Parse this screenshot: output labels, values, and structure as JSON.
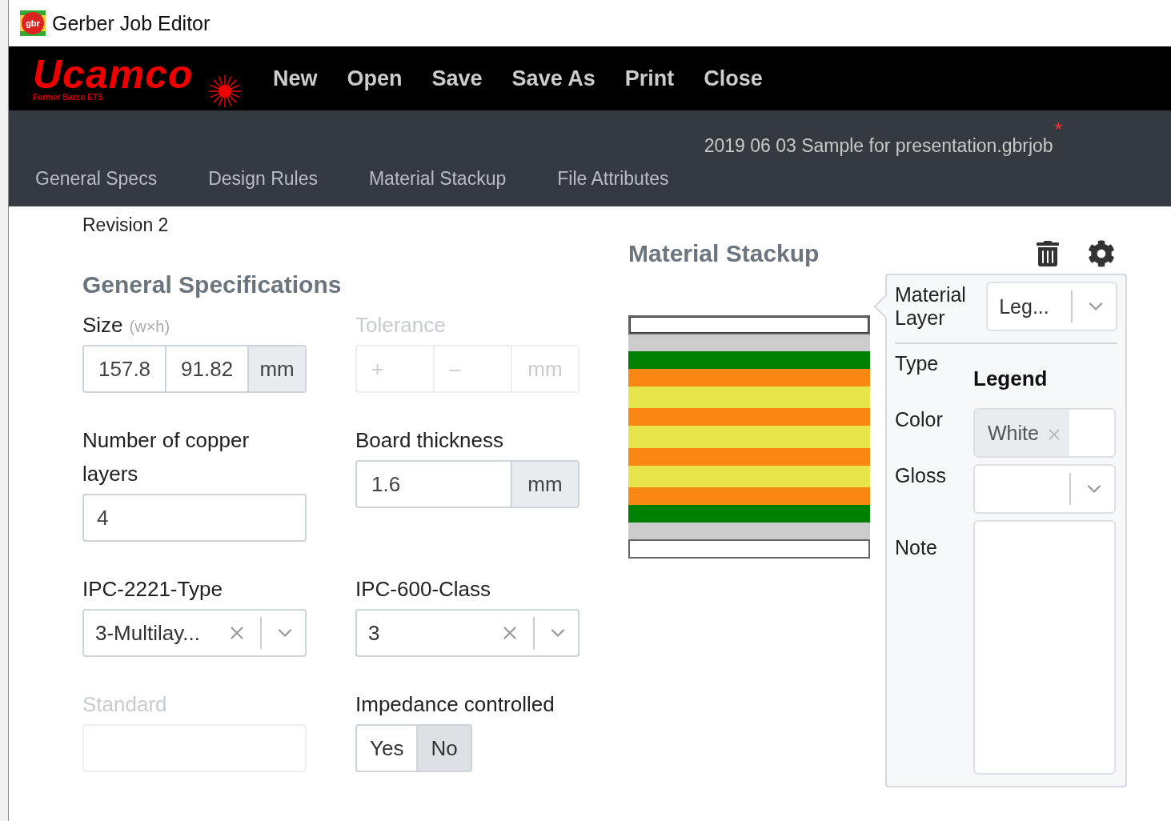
{
  "window": {
    "title": "Gerber Job Editor",
    "icon_label": "gbr"
  },
  "brand": {
    "name": "Ucamco",
    "tagline": "Former Barco ETS"
  },
  "menu": [
    {
      "label": "New"
    },
    {
      "label": "Open"
    },
    {
      "label": "Save"
    },
    {
      "label": "Save As"
    },
    {
      "label": "Print"
    },
    {
      "label": "Close"
    }
  ],
  "file": {
    "name": "2019 06 03 Sample for presentation.gbrjob",
    "modified_mark": "*"
  },
  "tabs": [
    {
      "label": "General Specs",
      "selected": false
    },
    {
      "label": "Design Rules",
      "selected": false
    },
    {
      "label": "Material Stackup",
      "selected": false
    },
    {
      "label": "File Attributes",
      "selected": false
    }
  ],
  "revision": "Revision 2",
  "general_specs": {
    "title": "General Specifications",
    "fields": [
      {
        "kind": "multi",
        "label": "Size",
        "hint": "(w×h)",
        "disabled": false,
        "parts": [
          {
            "value": "157.8"
          },
          {
            "value": "91.82"
          }
        ],
        "unit": "mm"
      },
      {
        "kind": "multi",
        "label": "Tolerance",
        "disabled": true,
        "parts": [
          {
            "placeholder": "+"
          },
          {
            "placeholder": "–"
          }
        ],
        "unit": "mm"
      },
      {
        "kind": "text",
        "label": "Number of copper layers",
        "disabled": false,
        "value": "4"
      },
      {
        "kind": "unit",
        "label": "Board thickness",
        "disabled": false,
        "value": "1.6",
        "unit": "mm"
      },
      {
        "kind": "select",
        "label": "IPC-2221-Type",
        "disabled": false,
        "value": "3-Multilay..."
      },
      {
        "kind": "select",
        "label": "IPC-600-Class",
        "disabled": false,
        "value": "3"
      },
      {
        "kind": "text",
        "label": "Standard",
        "disabled": true
      },
      {
        "kind": "toggle",
        "label": "Impedance controlled",
        "disabled": false,
        "options": [
          {
            "label": "Yes",
            "selected": false
          },
          {
            "label": "No",
            "selected": true
          }
        ]
      }
    ]
  },
  "material_stackup": {
    "title": "Material Stackup",
    "layers": [
      {
        "kind": "outline",
        "color": "#ffffff",
        "selected": true
      },
      {
        "kind": "fill",
        "color": "#cccccc",
        "selected": false
      },
      {
        "kind": "fill",
        "color": "#008000",
        "selected": false
      },
      {
        "kind": "fill",
        "color": "#f98712",
        "selected": false
      },
      {
        "kind": "fill",
        "color": "#e6e64a",
        "selected": false
      },
      {
        "kind": "fill",
        "color": "#f98712",
        "selected": false
      },
      {
        "kind": "fill",
        "color": "#e6e64a",
        "selected": false
      },
      {
        "kind": "fill",
        "color": "#f98712",
        "selected": false
      },
      {
        "kind": "fill",
        "color": "#e6e64a",
        "selected": false
      },
      {
        "kind": "fill",
        "color": "#f98712",
        "selected": false
      },
      {
        "kind": "fill",
        "color": "#008000",
        "selected": false
      },
      {
        "kind": "fill",
        "color": "#cccccc",
        "selected": false
      },
      {
        "kind": "outline",
        "color": "#ffffff",
        "selected": false
      }
    ],
    "editor": {
      "material_layer": {
        "label": "Material Layer",
        "value": "Leg..."
      },
      "type": {
        "label": "Type",
        "value": "Legend"
      },
      "color": {
        "label": "Color",
        "value": "White"
      },
      "gloss": {
        "label": "Gloss"
      },
      "note": {
        "label": "Note"
      }
    }
  }
}
